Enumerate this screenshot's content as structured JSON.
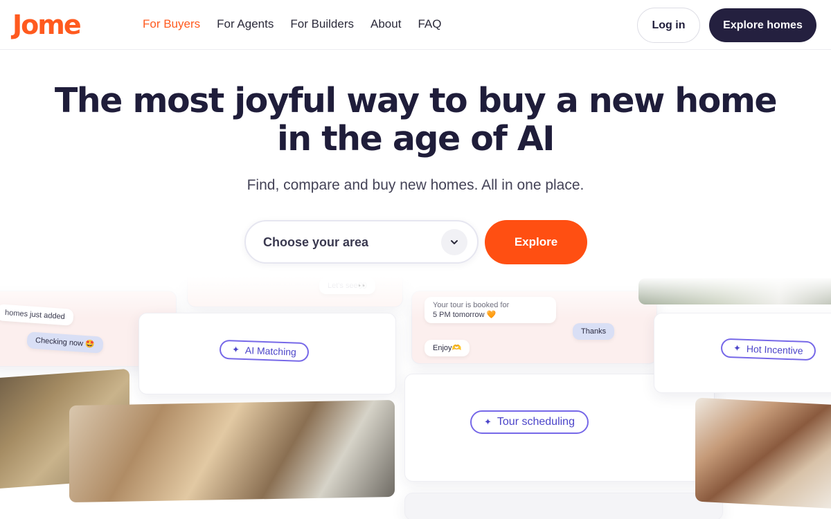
{
  "brand": {
    "logo_text": "Jome",
    "accent": "#ff5a1f",
    "dark": "#24203f"
  },
  "nav": {
    "items": [
      {
        "label": "For Buyers",
        "active": true
      },
      {
        "label": "For Agents",
        "active": false
      },
      {
        "label": "For Builders",
        "active": false
      },
      {
        "label": "About",
        "active": false
      },
      {
        "label": "FAQ",
        "active": false
      }
    ],
    "login_label": "Log in",
    "explore_homes_label": "Explore homes"
  },
  "hero": {
    "title_line1": "The most joyful way to buy a new home",
    "title_line2": "in the age of AI",
    "subtitle": "Find, compare and buy new homes. All in one place.",
    "area_placeholder": "Choose your area",
    "explore_label": "Explore"
  },
  "collage": {
    "chat_left": {
      "msg1": "homes just added",
      "msg2": "Checking now 🤩"
    },
    "lets_see": "Let's see👀",
    "chip_ai_matching": "AI Matching",
    "chat_tour": {
      "msg1_line1": "Your tour is booked for",
      "msg1_line2": "5 PM tomorrow 🧡",
      "reply": "Thanks",
      "msg2": "Enjoy🫶"
    },
    "chip_hot_incentives": "Hot Incentive",
    "chip_tour_scheduling": "Tour scheduling"
  }
}
